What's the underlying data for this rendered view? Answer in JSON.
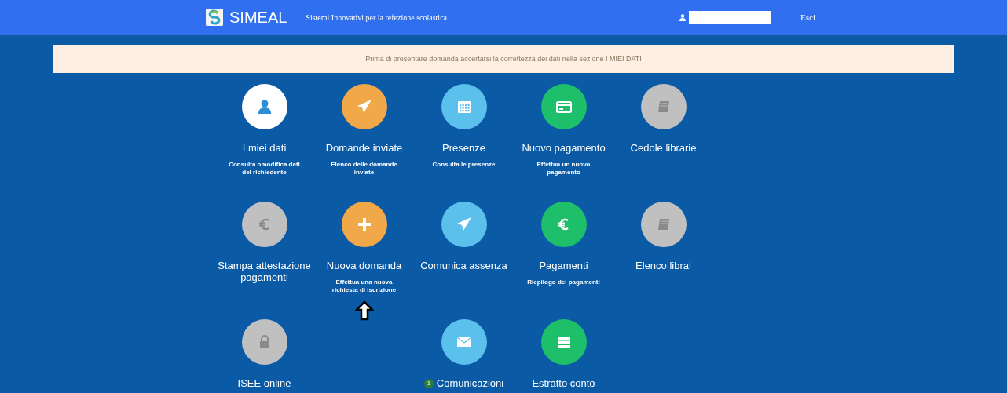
{
  "header": {
    "logo": "SIMEAL",
    "tagline": "Sistemi Innovativi per la refezione scolastica",
    "logout": "Esci"
  },
  "notice": "Prima di presentare domanda accertarsi la correttezza dei dati nella sezione I MIEI DATI",
  "tiles": [
    {
      "kind": "person",
      "color": "#ffffff",
      "title": "I miei dati",
      "description": "Consulta omodifica dati del richiedente"
    },
    {
      "kind": "plane",
      "color": "#f0a848",
      "title": "Domande inviate",
      "description": "Elenco delle domande inviate"
    },
    {
      "kind": "calendar",
      "color": "#5bc0eb",
      "title": "Presenze",
      "description": "Consulta le presenze"
    },
    {
      "kind": "card",
      "color": "#1dbf6b",
      "title": "Nuovo pagamento",
      "description": "Effettua un nuovo pagamento"
    },
    {
      "kind": "book",
      "color": "#c0c0c0",
      "title": "Cedole librarie"
    },
    {
      "kind": "euro",
      "color": "#c0c0c0",
      "title": "Stampa attestazione pagamenti"
    },
    {
      "kind": "plus",
      "color": "#f0a848",
      "title": "Nuova domanda",
      "description": "Effettua una nuova richiesta di iscrizione"
    },
    {
      "kind": "plane",
      "color": "#5bc0eb",
      "title": "Comunica assenza"
    },
    {
      "kind": "euro",
      "color": "#1dbf6b",
      "title": "Pagamenti",
      "description": "Riepilogo dei pagamenti"
    },
    {
      "kind": "book",
      "color": "#c0c0c0",
      "title": "Elenco librai"
    },
    {
      "kind": "lock",
      "color": "#c0c0c0",
      "title": "ISEE online"
    },
    {
      "kind": "blank"
    },
    {
      "kind": "envelope",
      "color": "#5bc0eb",
      "title": "Comunicazioni",
      "badge": "1"
    },
    {
      "kind": "list",
      "color": "#1dbf6b",
      "title": "Estratto conto"
    }
  ]
}
